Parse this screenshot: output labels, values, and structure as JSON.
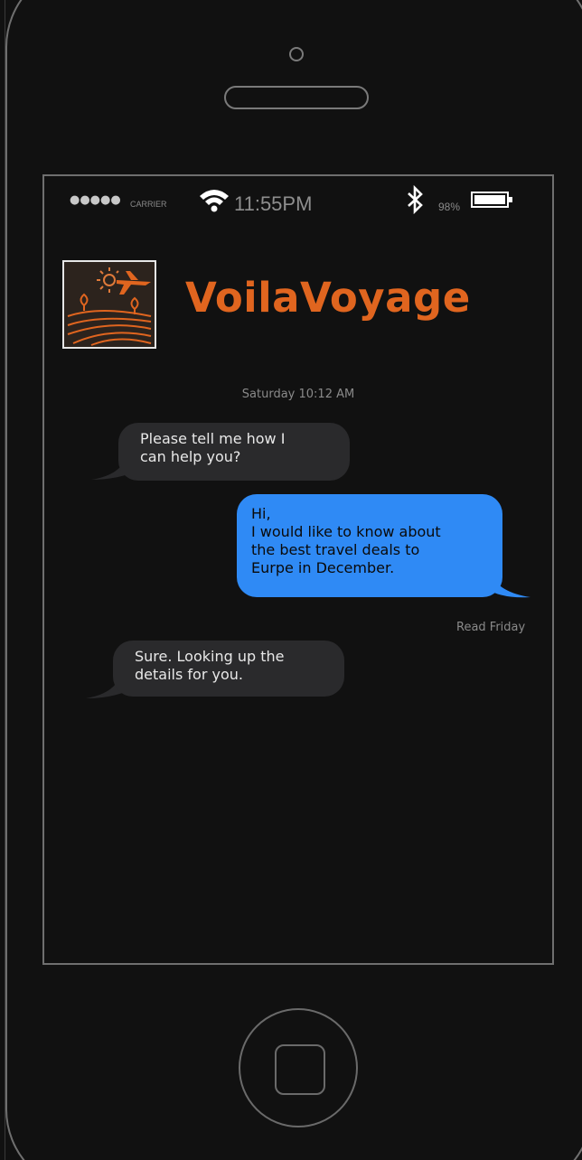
{
  "status_bar": {
    "signal": "●●●●●",
    "carrier": "CARRIER",
    "time": "11:55PM",
    "battery_percent": "98%"
  },
  "header": {
    "brand_name": "VoilaVoyage",
    "logo_icon": "travel-landscape-plane-icon"
  },
  "conversation": {
    "timestamp": "Saturday 10:12 AM",
    "messages": [
      {
        "direction": "incoming",
        "text": "Please tell me how I\ncan help you?"
      },
      {
        "direction": "outgoing",
        "text": "Hi,\nI would like to know about\nthe best travel deals to\nEurpe in December."
      },
      {
        "direction": "incoming",
        "text": "Sure. Looking up the\ndetails for you."
      }
    ],
    "read_receipt": "Read Friday"
  },
  "colors": {
    "brand": "#e0651f",
    "incoming_bubble": "#2a2a2c",
    "outgoing_bubble": "#2f8af5",
    "background": "#111111"
  }
}
